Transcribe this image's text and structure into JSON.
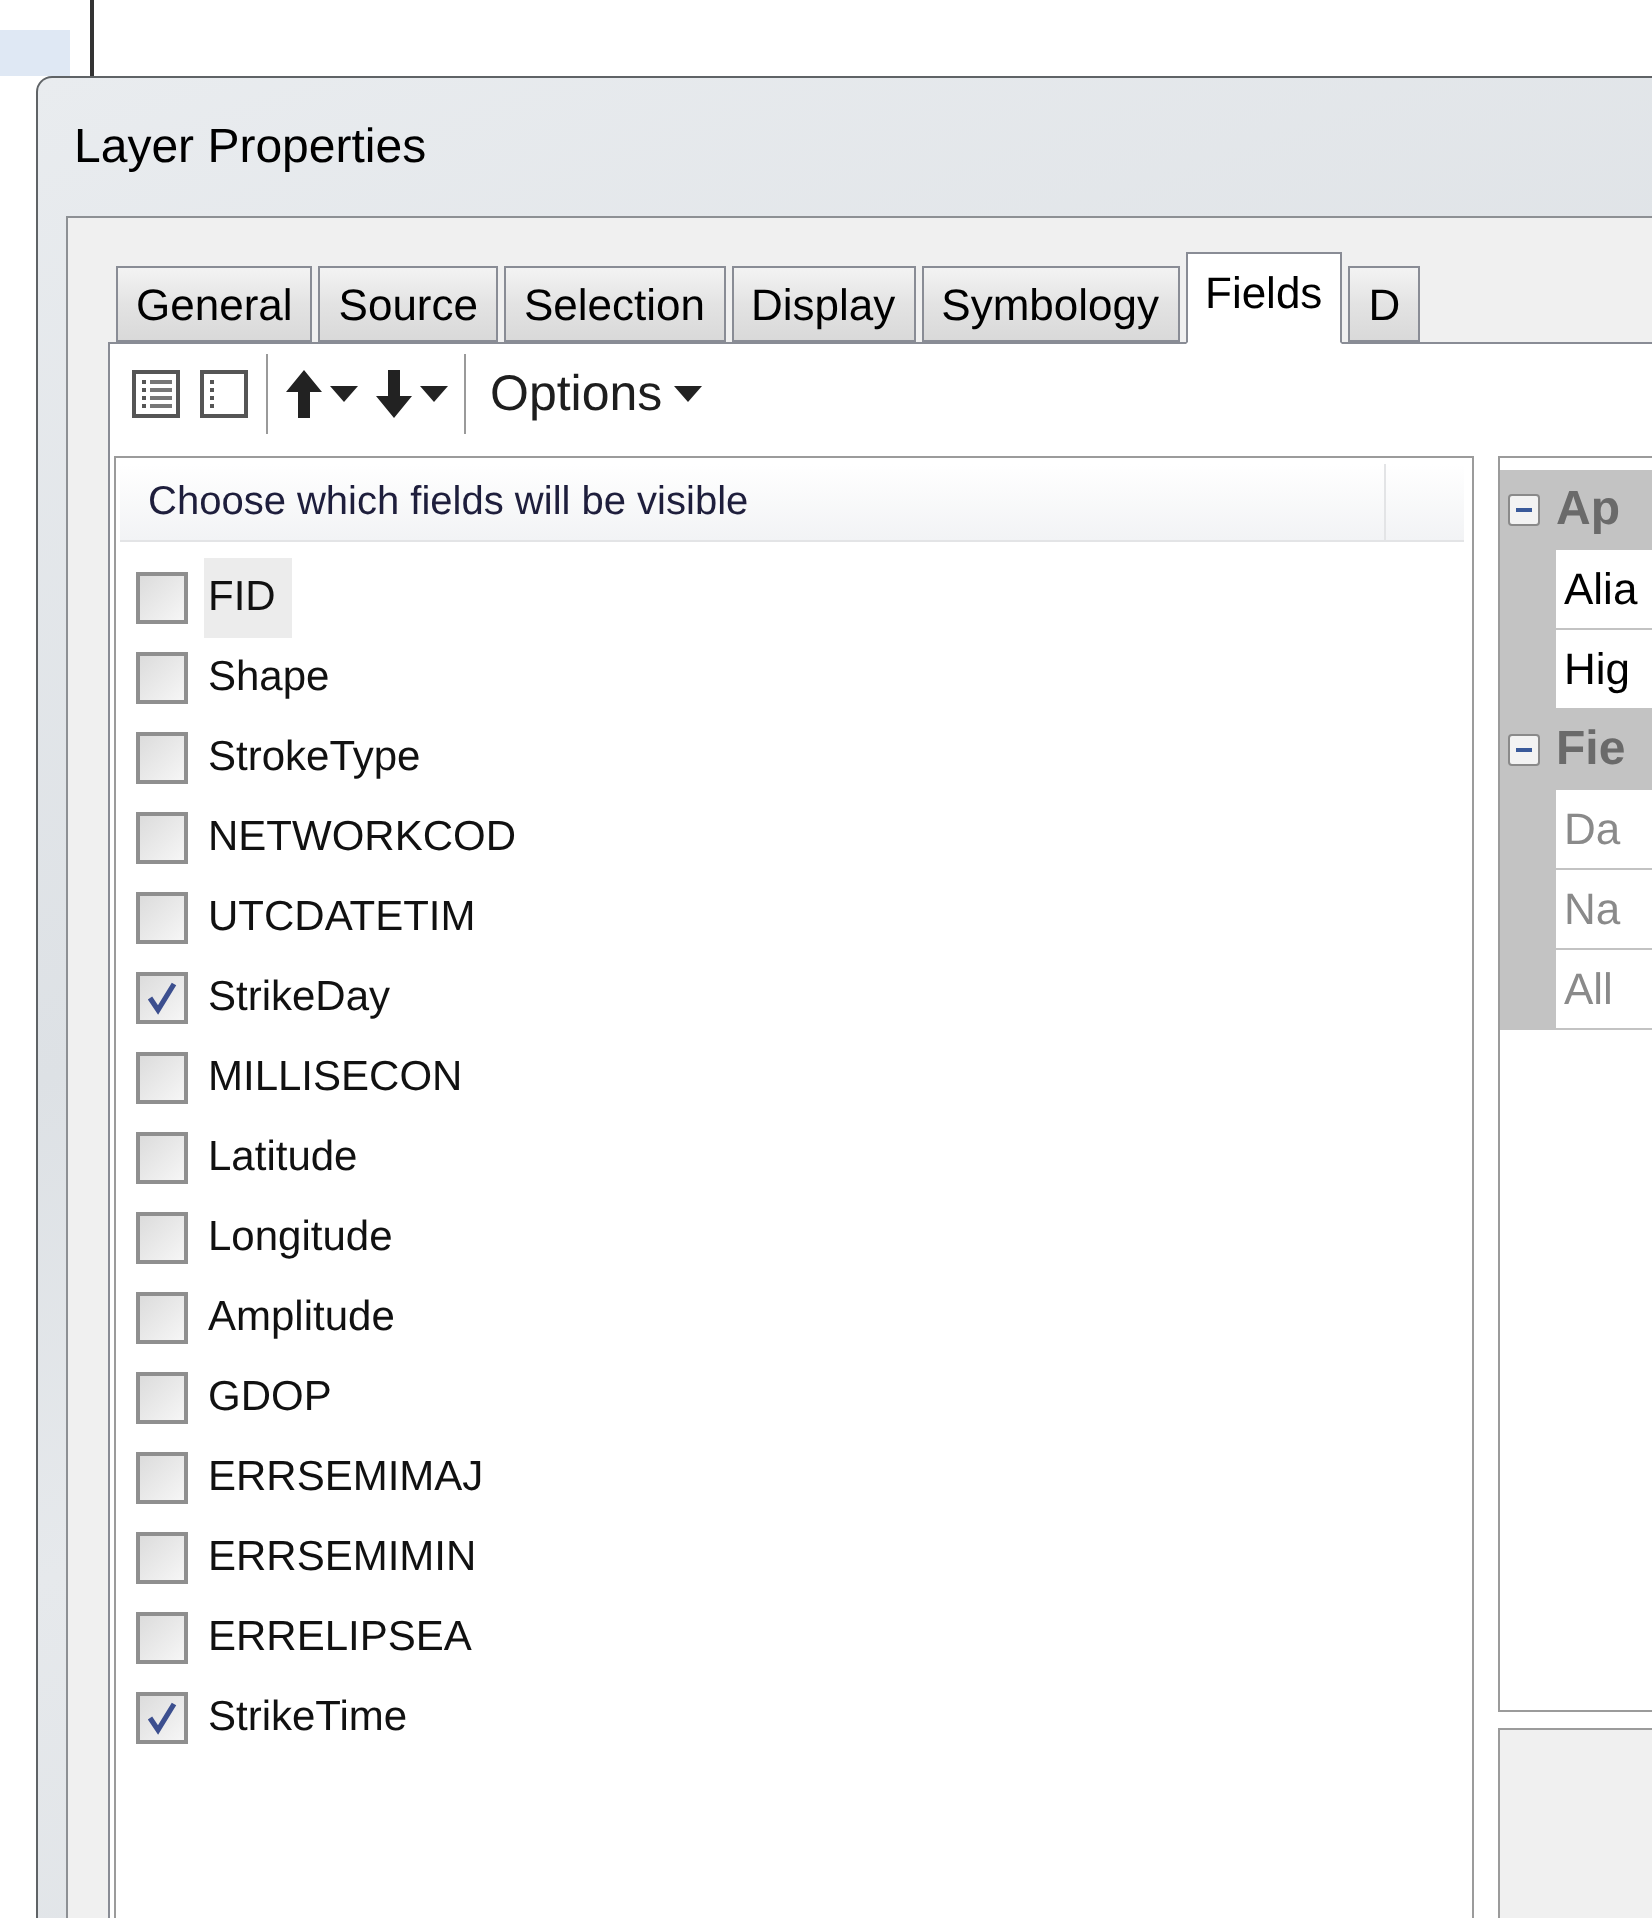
{
  "window": {
    "title": "Layer Properties"
  },
  "tabs": [
    {
      "label": "General",
      "selected": false
    },
    {
      "label": "Source",
      "selected": false
    },
    {
      "label": "Selection",
      "selected": false
    },
    {
      "label": "Display",
      "selected": false
    },
    {
      "label": "Symbology",
      "selected": false
    },
    {
      "label": "Fields",
      "selected": true
    },
    {
      "label": "D",
      "selected": false
    }
  ],
  "toolbar": {
    "options_label": "Options"
  },
  "fields_list": {
    "header": "Choose which fields will be visible",
    "items": [
      {
        "name": "FID",
        "checked": false,
        "selected": true
      },
      {
        "name": "Shape",
        "checked": false,
        "selected": false
      },
      {
        "name": "StrokeType",
        "checked": false,
        "selected": false
      },
      {
        "name": "NETWORKCOD",
        "checked": false,
        "selected": false
      },
      {
        "name": "UTCDATETIM",
        "checked": false,
        "selected": false
      },
      {
        "name": "StrikeDay",
        "checked": true,
        "selected": false
      },
      {
        "name": "MILLISECON",
        "checked": false,
        "selected": false
      },
      {
        "name": "Latitude",
        "checked": false,
        "selected": false
      },
      {
        "name": "Longitude",
        "checked": false,
        "selected": false
      },
      {
        "name": "Amplitude",
        "checked": false,
        "selected": false
      },
      {
        "name": "GDOP",
        "checked": false,
        "selected": false
      },
      {
        "name": "ERRSEMIMAJ",
        "checked": false,
        "selected": false
      },
      {
        "name": "ERRSEMIMIN",
        "checked": false,
        "selected": false
      },
      {
        "name": "ERRELIPSEA",
        "checked": false,
        "selected": false
      },
      {
        "name": "StrikeTime",
        "checked": true,
        "selected": false
      }
    ]
  },
  "property_grid": {
    "sections": [
      {
        "title": "Ap",
        "expanded": true,
        "rows": [
          {
            "label": "Alia",
            "disabled": false
          },
          {
            "label": "Hig",
            "disabled": false
          }
        ]
      },
      {
        "title": "Fie",
        "expanded": true,
        "rows": [
          {
            "label": "Da",
            "disabled": true
          },
          {
            "label": "Na",
            "disabled": true
          },
          {
            "label": "All",
            "disabled": true
          }
        ]
      }
    ]
  }
}
